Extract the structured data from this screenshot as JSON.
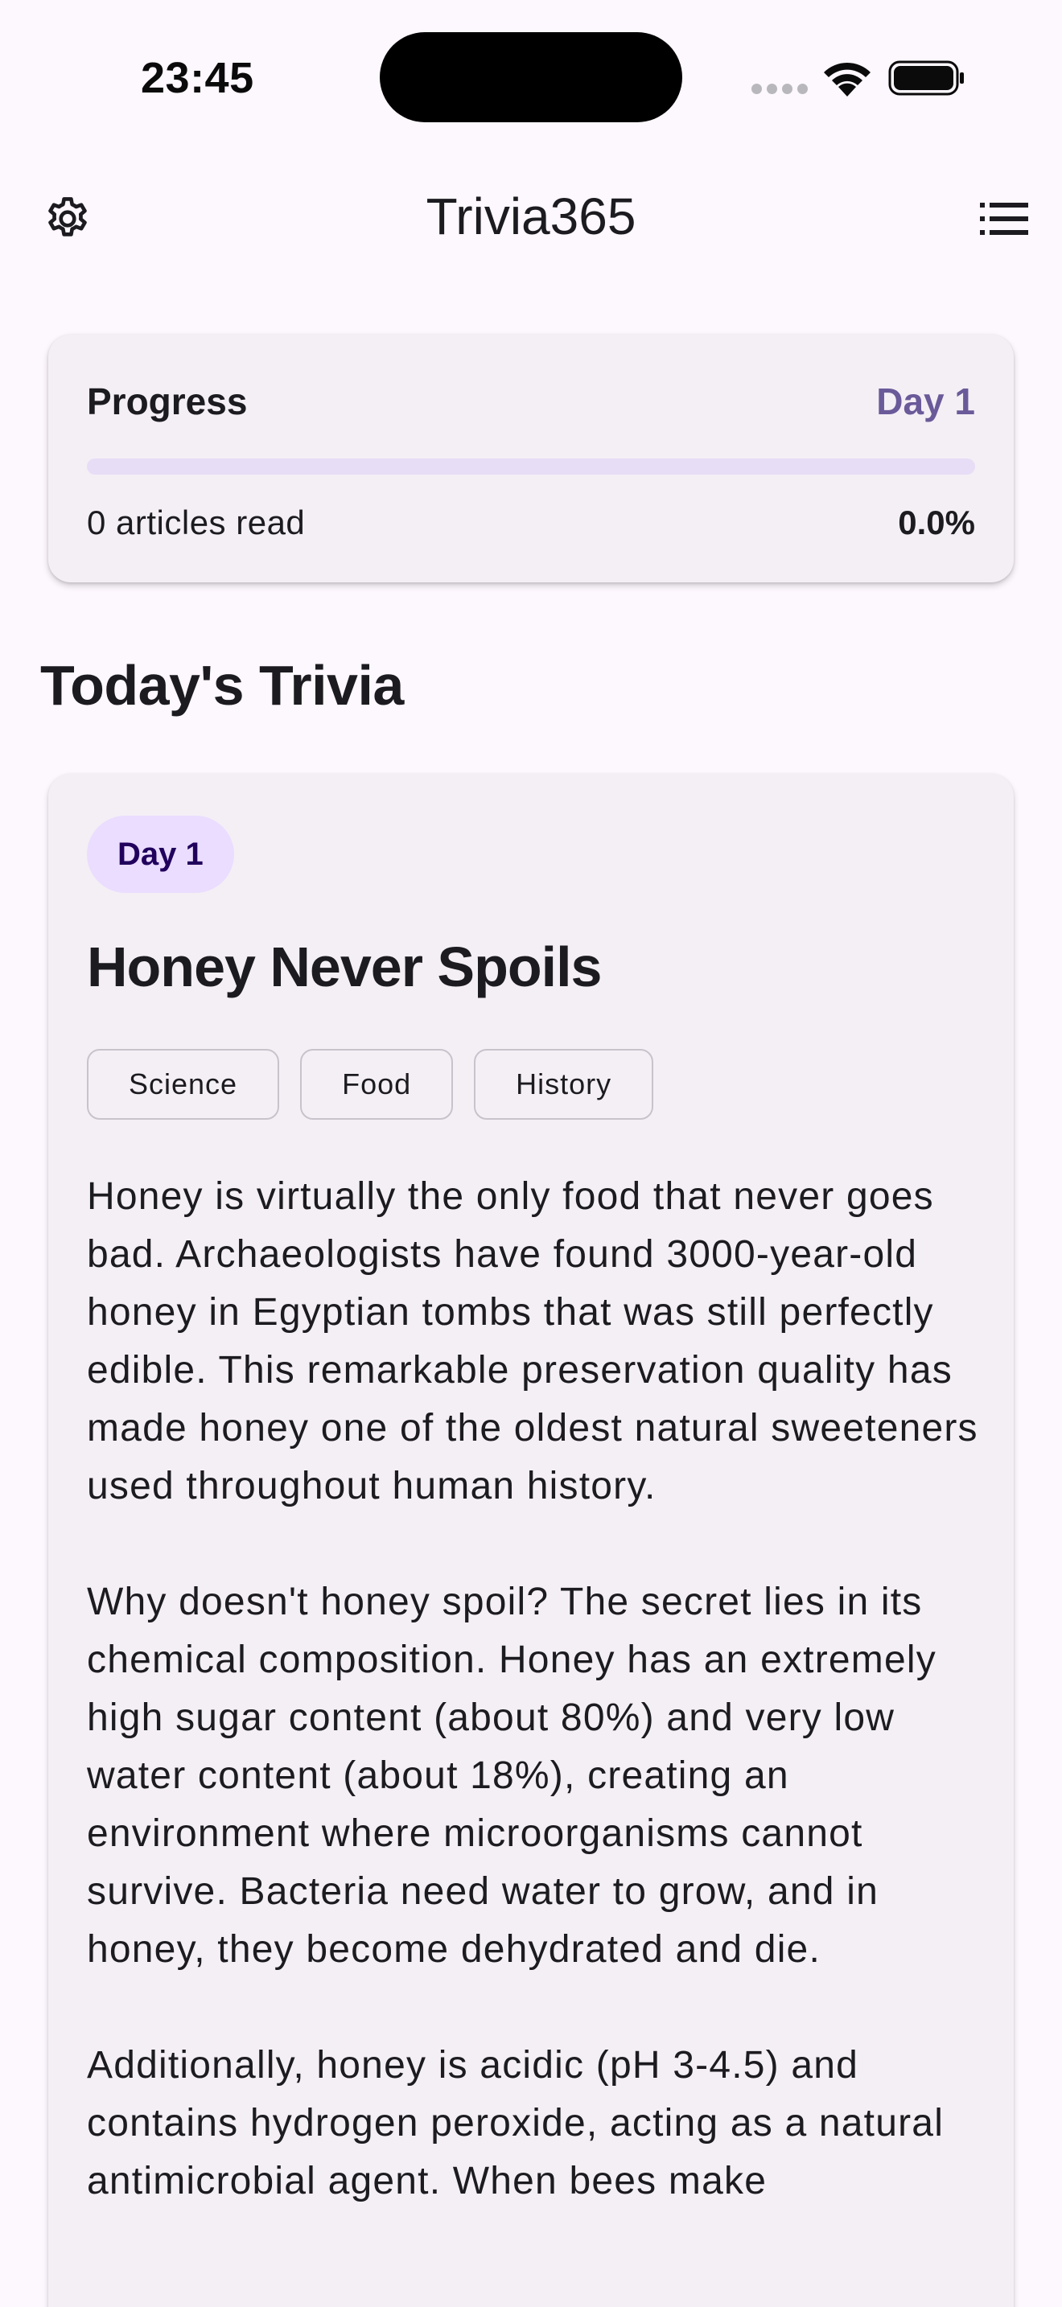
{
  "status_bar": {
    "time": "23:45"
  },
  "app_bar": {
    "title": "Trivia365",
    "left_icon": "gear-icon",
    "right_icon": "list-icon"
  },
  "progress": {
    "label": "Progress",
    "day": "Day 1",
    "articles_read": "0 articles read",
    "percent_text": "0.0%",
    "fraction": 0.0
  },
  "section_title": "Today's Trivia",
  "trivia": {
    "day_badge": "Day 1",
    "title": "Honey Never Spoils",
    "tags": [
      "Science",
      "Food",
      "History"
    ],
    "paragraphs": [
      "Honey is virtually the only food that never goes bad. Archaeologists have found 3000-year-old honey in Egyptian tombs that was still perfectly edible. This remarkable preservation quality has made honey one of the oldest natural sweeteners used throughout human history.",
      "Why doesn't honey spoil? The secret lies in its chemical composition. Honey has an extremely high sugar content (about 80%) and very low water content (about 18%), creating an environment where microorganisms cannot survive. Bacteria need water to grow, and in honey, they become dehydrated and die.",
      "Additionally, honey is acidic (pH 3-4.5) and contains hydrogen peroxide, acting as a natural antimicrobial agent. When bees make"
    ]
  },
  "colors": {
    "background": "#fdf7fe",
    "card": "#f4eff5",
    "accent": "#6a5a99",
    "badge": "#eaddff",
    "track": "#e7ddf6"
  }
}
